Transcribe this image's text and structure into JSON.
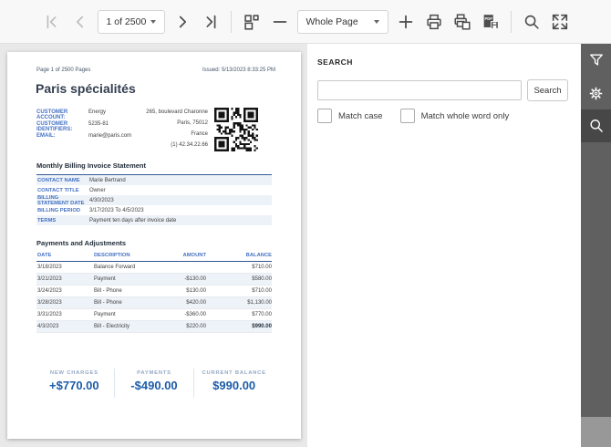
{
  "toolbar": {
    "page_select": "1 of 2500",
    "zoom_select": "Whole Page"
  },
  "search_panel": {
    "title": "SEARCH",
    "search_button": "Search",
    "match_case_label": "Match case",
    "match_whole_word_label": "Match whole word only"
  },
  "sidebar": {
    "tabs": [
      "parameters",
      "settings",
      "search"
    ],
    "active_tab": "search"
  },
  "icons": {
    "first-page": "|<",
    "previous-page": "<",
    "next-page": ">",
    "last-page": ">|",
    "page-organization": "squares-grid",
    "zoom-out": "minus",
    "zoom-in": "plus",
    "print": "printer",
    "print-page": "printer-with-page",
    "export": "pdf-save",
    "search": "magnifier",
    "fullscreen": "expand-arrows",
    "filter": "funnel",
    "settings": "gear"
  },
  "document": {
    "page_info": "Page 1 of 2500 Pages",
    "issued": "Issued: 5/13/2023 8:33:25 PM",
    "company_title": "Paris spécialités",
    "customer_fields": [
      {
        "label": "CUSTOMER ACCOUNT:",
        "value": "Energy"
      },
      {
        "label": "CUSTOMER IDENTIFIERS:",
        "value": "5235-81"
      },
      {
        "label": "EMAIL:",
        "value": "marie@paris.com"
      }
    ],
    "address_lines": [
      "265, boulevard Charonne",
      "Paris,  75012",
      "France",
      "(1) 42.34.22.66"
    ],
    "statement_heading": "Monthly Billing Invoice Statement",
    "statement_fields": [
      {
        "label": "CONTACT NAME",
        "value": "Marie Bertrand"
      },
      {
        "label": "CONTACT TITLE",
        "value": "Owner"
      },
      {
        "label": "BILLING STATEMENT DATE",
        "value": "4/30/2023"
      },
      {
        "label": "BILLING PERIOD",
        "value": "3/17/2023 To 4/5/2023"
      },
      {
        "label": "TERMS",
        "value": "Payment ten days after invoice date"
      }
    ],
    "payments_heading": "Payments and Adjustments",
    "payments_table": {
      "headers": [
        "DATE",
        "DESCRIPTION",
        "AMOUNT",
        "BALANCE"
      ],
      "rows": [
        [
          "3/18/2023",
          "Balance Forward",
          "",
          "$710.00"
        ],
        [
          "3/21/2023",
          "Payment",
          "-$130.00",
          "$580.00"
        ],
        [
          "3/24/2023",
          "Bill - Phone",
          "$130.00",
          "$710.00"
        ],
        [
          "3/28/2023",
          "Bill - Phone",
          "$420.00",
          "$1,130.00"
        ],
        [
          "3/31/2023",
          "Payment",
          "-$360.00",
          "$770.00"
        ],
        [
          "4/3/2023",
          "Bill - Electricity",
          "$220.00",
          "$990.00"
        ]
      ]
    },
    "summary": [
      {
        "label": "NEW CHARGES",
        "value": "+$770.00"
      },
      {
        "label": "PAYMENTS",
        "value": "-$490.00"
      },
      {
        "label": "CURRENT BALANCE",
        "value": "$990.00"
      }
    ]
  },
  "colors": {
    "accent_blue": "#4472c4",
    "header_rule_blue": "#2f5496",
    "summary_value_blue": "#1d5ca9",
    "toolbar_bg": "#f8f8f8",
    "viewer_bg": "#e9e9e9",
    "sidebar_bg": "#606060",
    "sidebar_active_bg": "#474747"
  }
}
